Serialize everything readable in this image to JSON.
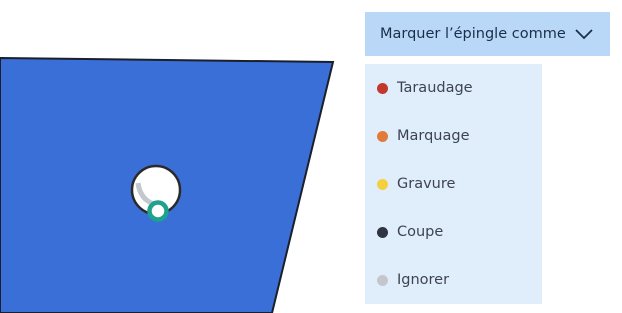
{
  "dropdown": {
    "label": "Marquer l’épingle comme",
    "icon": "chevron-down-icon"
  },
  "menu": {
    "items": [
      {
        "label": "Taraudage",
        "color": "#c0392b"
      },
      {
        "label": "Marquage",
        "color": "#e07b39"
      },
      {
        "label": "Gravure",
        "color": "#f4d03f"
      },
      {
        "label": "Coupe",
        "color": "#2e3440"
      },
      {
        "label": "Ignorer",
        "color": "#c3c6cc"
      }
    ]
  },
  "colors": {
    "plate": "#3a6fd8",
    "pin_marker": "#1fa28c",
    "dropdown_bg": "#b9d8f7",
    "menu_bg": "#e0eefc"
  }
}
